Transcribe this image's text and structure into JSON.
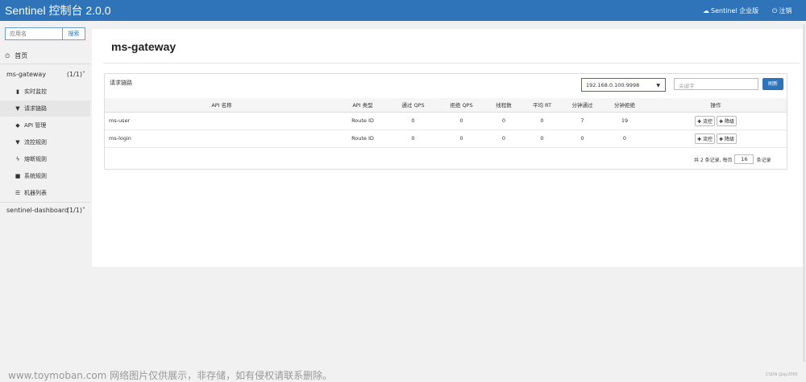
{
  "header": {
    "brand": "Sentinel 控制台 2.0.0",
    "enterprise_label": "Sentinel 企业版",
    "logout_label": "注销"
  },
  "sidebar": {
    "search_placeholder": "应用名",
    "search_button": "搜索",
    "home_label": "首页",
    "app1": {
      "name": "ms-gateway",
      "count": "(1/1)"
    },
    "items": [
      {
        "label": "实时监控",
        "icon": "bar-chart-icon"
      },
      {
        "label": "请求链路",
        "icon": "filter-icon"
      },
      {
        "label": "API 管理",
        "icon": "tags-icon"
      },
      {
        "label": "流控规则",
        "icon": "filter-icon"
      },
      {
        "label": "熔断规则",
        "icon": "flash-icon"
      },
      {
        "label": "系统规则",
        "icon": "lock-icon"
      },
      {
        "label": "机器列表",
        "icon": "list-icon"
      }
    ],
    "app2": {
      "name": "sentinel-dashboard",
      "count": "(1/1)"
    }
  },
  "main": {
    "title": "ms-gateway",
    "panel_title": "请求链路",
    "machine": "192.168.0.100:9998",
    "keyword_placeholder": "关键字",
    "refresh_label": "刷新",
    "columns": [
      "API 名称",
      "API 类型",
      "通过 QPS",
      "拒绝 QPS",
      "线程数",
      "平均 RT",
      "分钟通过",
      "分钟拒绝",
      "操作"
    ],
    "rows": [
      {
        "name": "ms-user",
        "type": "Route ID",
        "pass_qps": "0",
        "block_qps": "0",
        "threads": "0",
        "avg_rt": "0",
        "min_pass": "7",
        "min_block": "19"
      },
      {
        "name": "ms-login",
        "type": "Route ID",
        "pass_qps": "0",
        "block_qps": "0",
        "threads": "0",
        "avg_rt": "0",
        "min_pass": "0",
        "min_block": "0"
      }
    ],
    "flow_btn": "流控",
    "degrade_btn": "降级",
    "pager_prefix": "共 2 条记录, 每页",
    "page_size": "16",
    "pager_suffix": "条记录"
  },
  "watermark": "www.toymoban.com 网络图片仅供展示，非存储，如有侵权请联系删除。",
  "csdn": "CSDN @qy2065"
}
